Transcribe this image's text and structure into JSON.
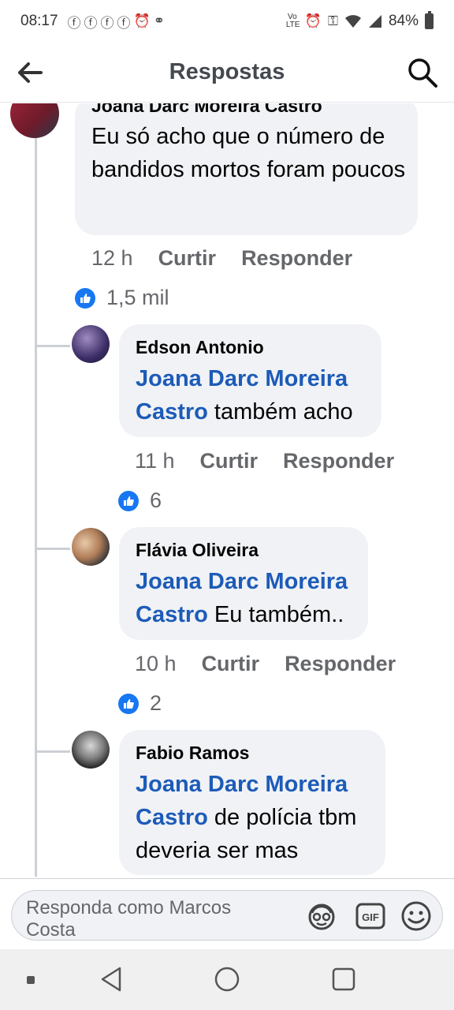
{
  "status_bar": {
    "time": "08:17",
    "left_icons": [
      "facebook-icon",
      "facebook-icon",
      "facebook-icon",
      "facebook-icon",
      "alarm-icon",
      "voicemail-icon"
    ],
    "network": "Vo LTE",
    "battery": "84%"
  },
  "header": {
    "title": "Respostas"
  },
  "comments": [
    {
      "author": "Joana Darc Moreira Castro",
      "mention": "",
      "text": "Eu só acho que o número de bandidos mortos foram poucos",
      "time": "12 h",
      "like_label": "Curtir",
      "reply_label": "Responder",
      "likes": "1,5 mil"
    },
    {
      "author": "Edson Antonio",
      "mention": "Joana Darc Moreira Castro",
      "text": " também acho",
      "time": "11 h",
      "like_label": "Curtir",
      "reply_label": "Responder",
      "likes": "6"
    },
    {
      "author": "Flávia Oliveira",
      "mention": "Joana Darc Moreira Castro",
      "text": " Eu também..",
      "time": "10 h",
      "like_label": "Curtir",
      "reply_label": "Responder",
      "likes": "2"
    },
    {
      "author": "Fabio Ramos",
      "mention": "Joana Darc Moreira Castro",
      "text": " de polícia tbm deveria ser mas",
      "time": "",
      "like_label": "",
      "reply_label": "",
      "likes": ""
    }
  ],
  "composer": {
    "placeholder": "Responda como Marcos Costa"
  },
  "colors": {
    "accent": "#1877f2",
    "mention": "#1d5bb8",
    "bubble": "#f0f2f5",
    "meta": "#65676b"
  }
}
